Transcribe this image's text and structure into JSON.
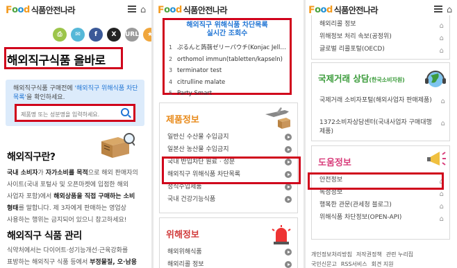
{
  "logo": {
    "f": "F",
    "o1": "o",
    "o2": "o",
    "d": "d",
    "kr": "식품안전나라"
  },
  "panel1": {
    "share_icons": [
      {
        "name": "print-icon",
        "label": "⎙",
        "color": "#9cc54a"
      },
      {
        "name": "email-icon",
        "label": "✉",
        "color": "#56b8d8"
      },
      {
        "name": "facebook-icon",
        "label": "f",
        "color": "#3b5998"
      },
      {
        "name": "x-icon",
        "label": "X",
        "color": "#222222"
      },
      {
        "name": "url-icon",
        "label": "URL",
        "color": "#9a9a9a"
      },
      {
        "name": "star-icon",
        "label": "★",
        "color": "#f0a63c"
      }
    ],
    "page_title": "해외직구식품 올바로",
    "intro_before": "해외직구식품 구매전에 ",
    "intro_highlight": "'해외직구 위해식품 차단목록'",
    "intro_after": "을 확인하세요.",
    "search_placeholder": "제품명 또는 성분명을 입력하세요.",
    "section1_title": "해외직구란?",
    "section1_lines": [
      {
        "b1": "국내 소비자",
        "t1": "가 ",
        "b2": "자가소비를 목적",
        "t2": "으로 해외 판매자의"
      },
      {
        "b1": "",
        "t1": "사이트(국내 포털사 및 오픈마켓에 입점한 해외",
        "b2": "",
        "t2": ""
      },
      {
        "b1": "",
        "t1": "사업자 포함)에서 ",
        "b2": "해외상품을 직접 구매하는 소비",
        "t2": ""
      },
      {
        "b1": "형태",
        "t1": "를 말합니다. 제 3자에게 판매하는 영업상",
        "b2": "",
        "t2": ""
      },
      {
        "b1": "",
        "t1": "사용하는 행위는 금지되어 있으니 참고하세요!",
        "b2": "",
        "t2": ""
      }
    ],
    "section2_title": "해외직구 식품 관리",
    "section2_lines": [
      {
        "t1": "식약처에서는 다이어트·성기능개선·근육강화를",
        "b": ""
      },
      {
        "t1": "표방하는 해외직구 식품 등에서 ",
        "b": "부정물질, 오·남용"
      }
    ]
  },
  "panel2": {
    "alert_title_l1": "해외직구 위해식품 차단목록",
    "alert_title_l2": "실시간 조회수",
    "alert_items": [
      {
        "n": "1",
        "text": "ぷるんと蒟蒻ゼリーパウチ(Konjac Jell…"
      },
      {
        "n": "2",
        "text": "orthomol immun(tabletten/kapseln)"
      },
      {
        "n": "3",
        "text": "terminator test"
      },
      {
        "n": "4",
        "text": "citrulline malate"
      },
      {
        "n": "5",
        "text": "Party Smart"
      }
    ],
    "cat1_title": "제품정보",
    "cat1_items": [
      "일반신 수산물 수입금지",
      "일본산 농산물 수입금지",
      "국내 반입차단 원료 · 성분",
      "해외직구 위해식품 차단목록",
      "정식수입제품",
      "국내 건강기능식품"
    ],
    "cat2_title": "위해정보",
    "cat2_items": [
      "해외위해식품",
      "해외리콜 정보"
    ]
  },
  "panel3": {
    "top_items": [
      "해외리콜 정보",
      "위해정보 처리 속보(공정위)",
      "글로벌 리콜포털(OECD)"
    ],
    "cat3_title": "국제거래 상담",
    "cat3_sub": "(한국소비자원)",
    "cat3_items": [
      "국제거래 소비자포털(해외사업자 판매제품)",
      "1372소비자상담센터(국내사업자 구매대행제품)"
    ],
    "cat4_title": "도움정보",
    "cat4_items": [
      "안전정보",
      "독성정보",
      "행복한 관문(관세청 블로그)",
      "위해식품 차단정보(OPEN-API)"
    ],
    "footer_row1": [
      "개인정보처리방침",
      "저작권정책",
      "관련 누리집"
    ],
    "footer_row2": [
      "국민신문고",
      "RSS서비스",
      "회견 지원"
    ]
  }
}
